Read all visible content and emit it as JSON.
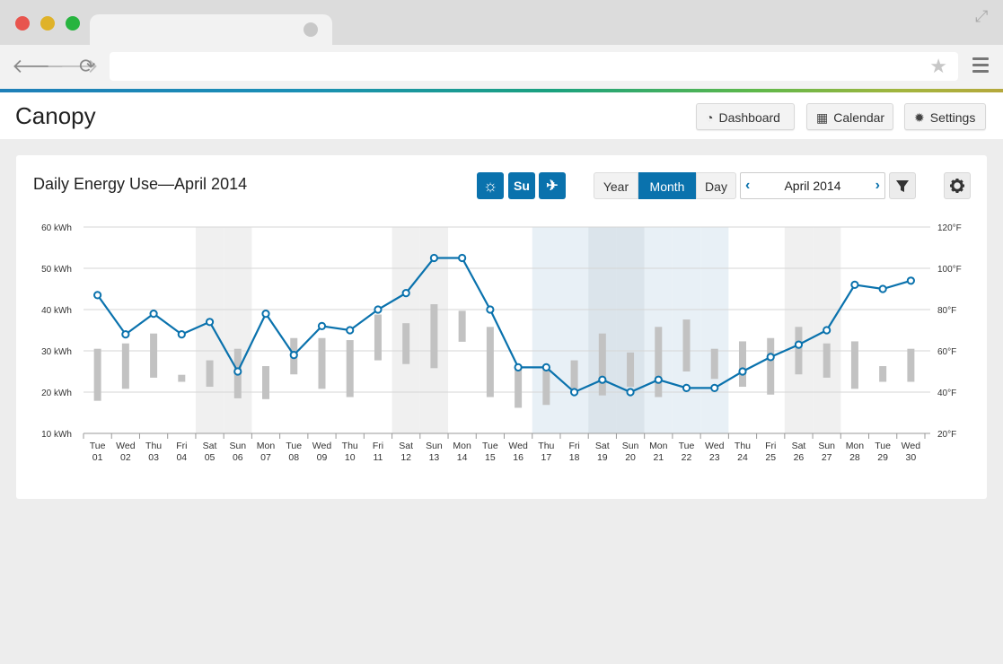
{
  "browser": {
    "icons": [
      "arrow-left-icon",
      "arrow-right-icon",
      "reload-icon",
      "star-icon",
      "menu-icon",
      "expand-icon"
    ],
    "colors": {
      "close": "#e8554e",
      "minimize": "#dfb229",
      "maximize": "#27b43f"
    }
  },
  "app": {
    "brand": "Canopy",
    "nav": [
      {
        "label": "Dashboard",
        "icon": "gauge-icon"
      },
      {
        "label": "Calendar",
        "icon": "calendar-icon"
      },
      {
        "label": "Settings",
        "icon": "gear-icon"
      }
    ],
    "accent": "#0a72ad"
  },
  "card": {
    "title": "Daily Energy Use—April 2014",
    "toggles": [
      {
        "label": "",
        "icon": "sun-icon"
      },
      {
        "label": "Su",
        "icon": ""
      },
      {
        "label": "",
        "icon": "plane-icon"
      }
    ],
    "views": [
      "Year",
      "Month",
      "Day"
    ],
    "active_view": "Month",
    "date_label": "April 2014",
    "icons": [
      "chevron-left-icon",
      "chevron-right-icon",
      "filter-icon",
      "gear-icon"
    ]
  },
  "chart_data": {
    "type": "bar",
    "left_axis": {
      "ticks": [
        "10 kWh",
        "20 kWh",
        "30 kWh",
        "40 kWh",
        "50 kWh",
        "60 kWh"
      ],
      "range": [
        10,
        60
      ]
    },
    "right_axis": {
      "ticks": [
        "20°F",
        "40°F",
        "60°F",
        "80°F",
        "100°F",
        "120°F"
      ],
      "range": [
        20,
        120
      ]
    },
    "days": [
      {
        "wd": "Tue",
        "d": "01"
      },
      {
        "wd": "Wed",
        "d": "02"
      },
      {
        "wd": "Thu",
        "d": "03"
      },
      {
        "wd": "Fri",
        "d": "04"
      },
      {
        "wd": "Sat",
        "d": "05"
      },
      {
        "wd": "Sun",
        "d": "06"
      },
      {
        "wd": "Mon",
        "d": "07"
      },
      {
        "wd": "Tue",
        "d": "08"
      },
      {
        "wd": "Wed",
        "d": "09"
      },
      {
        "wd": "Thu",
        "d": "10"
      },
      {
        "wd": "Fri",
        "d": "11"
      },
      {
        "wd": "Sat",
        "d": "12"
      },
      {
        "wd": "Sun",
        "d": "13"
      },
      {
        "wd": "Mon",
        "d": "14"
      },
      {
        "wd": "Tue",
        "d": "15"
      },
      {
        "wd": "Wed",
        "d": "16"
      },
      {
        "wd": "Thu",
        "d": "17"
      },
      {
        "wd": "Fri",
        "d": "18"
      },
      {
        "wd": "Sat",
        "d": "19"
      },
      {
        "wd": "Sun",
        "d": "20"
      },
      {
        "wd": "Mon",
        "d": "21"
      },
      {
        "wd": "Tue",
        "d": "22"
      },
      {
        "wd": "Wed",
        "d": "23"
      },
      {
        "wd": "Thu",
        "d": "24"
      },
      {
        "wd": "Fri",
        "d": "25"
      },
      {
        "wd": "Sat",
        "d": "26"
      },
      {
        "wd": "Sun",
        "d": "27"
      },
      {
        "wd": "Mon",
        "d": "28"
      },
      {
        "wd": "Tue",
        "d": "29"
      },
      {
        "wd": "Wed",
        "d": "30"
      }
    ],
    "energy_ranges_kwh": [
      [
        17.9,
        30.5
      ],
      [
        20.8,
        31.8
      ],
      [
        23.5,
        34.2
      ],
      [
        22.5,
        24.2
      ],
      [
        21.3,
        27.7
      ],
      [
        18.5,
        30.5
      ],
      [
        18.3,
        26.3
      ],
      [
        24.3,
        33.1
      ],
      [
        20.8,
        33.1
      ],
      [
        18.8,
        32.6
      ],
      [
        27.7,
        38.8
      ],
      [
        26.8,
        36.7
      ],
      [
        25.8,
        41.3
      ],
      [
        32.2,
        39.7
      ],
      [
        18.8,
        35.8
      ],
      [
        16.2,
        26.3
      ],
      [
        16.9,
        26.3
      ],
      [
        20.8,
        27.7
      ],
      [
        19.2,
        34.2
      ],
      [
        21.3,
        29.6
      ],
      [
        18.8,
        35.8
      ],
      [
        25.0,
        37.6
      ],
      [
        23.2,
        30.5
      ],
      [
        21.3,
        32.3
      ],
      [
        19.4,
        33.1
      ],
      [
        24.3,
        35.8
      ],
      [
        23.5,
        31.8
      ],
      [
        20.8,
        32.3
      ],
      [
        22.5,
        26.3
      ],
      [
        22.5,
        30.5
      ]
    ],
    "temperature_f": [
      87,
      68,
      78,
      68,
      74,
      50,
      78,
      58,
      72,
      70,
      80,
      88,
      105,
      105,
      80,
      52,
      52,
      40,
      46,
      40,
      46,
      42,
      42,
      50,
      57,
      63,
      70,
      92,
      90,
      94
    ],
    "weekend_days": [
      "05",
      "06",
      "12",
      "13",
      "26",
      "27"
    ],
    "vacation_days": [
      "17",
      "18",
      "19",
      "20",
      "21",
      "22",
      "23"
    ],
    "grid": true
  }
}
